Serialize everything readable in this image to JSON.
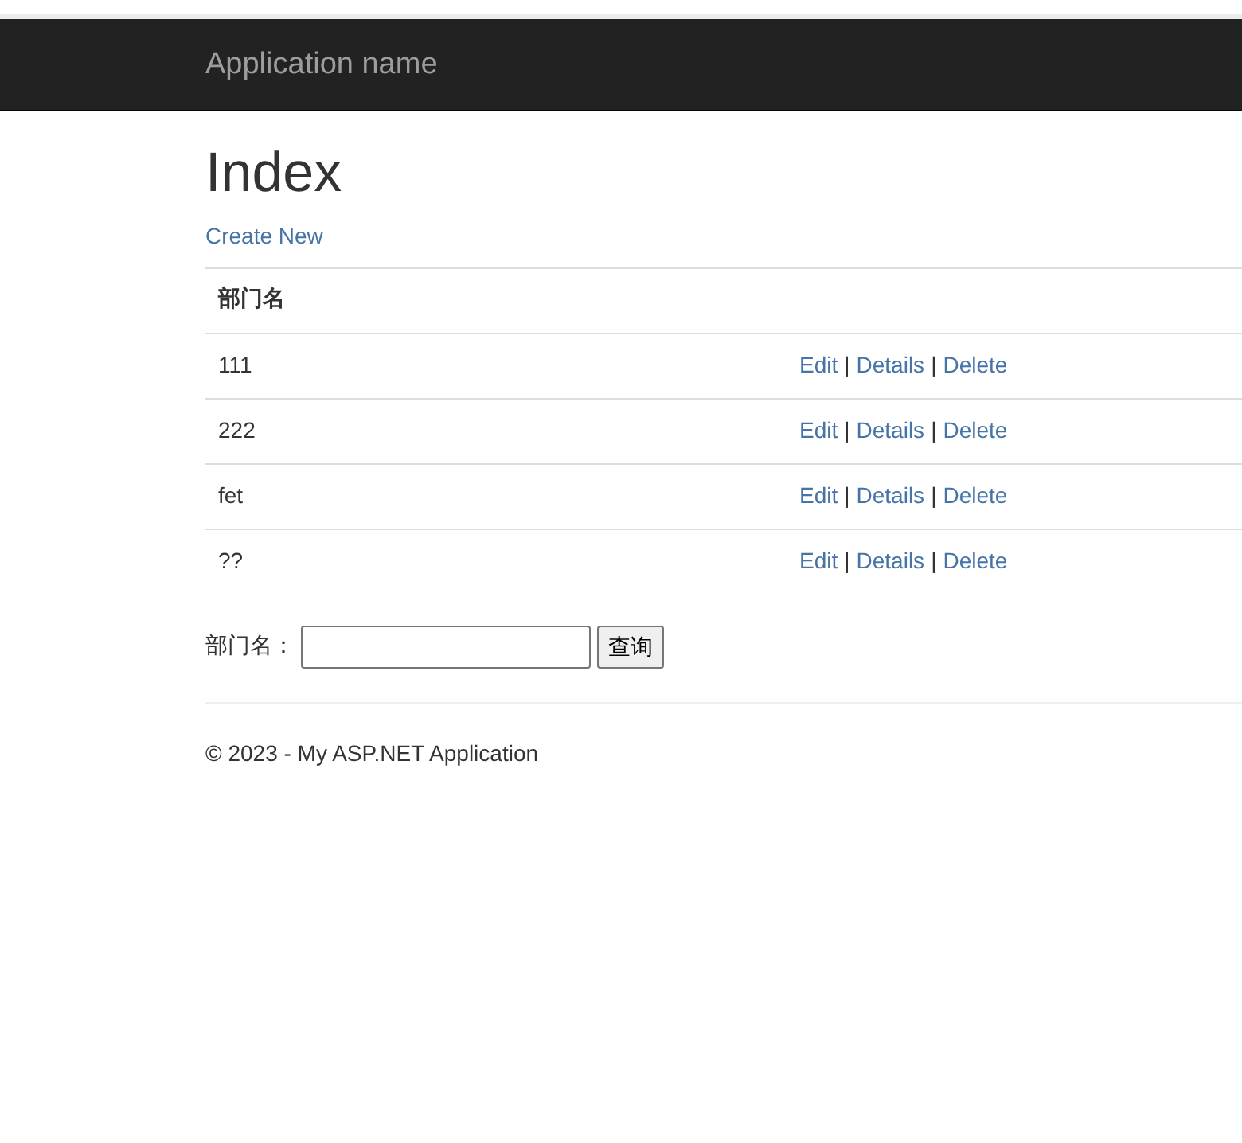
{
  "navbar": {
    "brand": "Application name"
  },
  "page": {
    "title": "Index",
    "create_link": "Create New"
  },
  "table": {
    "columns": [
      "部门名"
    ],
    "rows": [
      {
        "name": "111",
        "actions": [
          {
            "kind": "link",
            "text": "Edit"
          },
          {
            "kind": "separator",
            "text": "|"
          },
          {
            "kind": "link",
            "text": "Details"
          },
          {
            "kind": "separator",
            "text": "|"
          },
          {
            "kind": "link",
            "text": "Delete"
          }
        ]
      },
      {
        "name": "222",
        "actions": [
          {
            "kind": "link",
            "text": "Edit"
          },
          {
            "kind": "separator",
            "text": "|"
          },
          {
            "kind": "link",
            "text": "Details"
          },
          {
            "kind": "separator",
            "text": "|"
          },
          {
            "kind": "link",
            "text": "Delete"
          }
        ]
      },
      {
        "name": "fet",
        "actions": [
          {
            "kind": "link",
            "text": "Edit"
          },
          {
            "kind": "separator",
            "text": "|"
          },
          {
            "kind": "link",
            "text": "Details"
          },
          {
            "kind": "separator",
            "text": "|"
          },
          {
            "kind": "link",
            "text": "Delete"
          }
        ]
      },
      {
        "name": "??",
        "actions": [
          {
            "kind": "link",
            "text": "Edit"
          },
          {
            "kind": "separator",
            "text": "|"
          },
          {
            "kind": "link",
            "text": "Details"
          },
          {
            "kind": "separator",
            "text": "|"
          },
          {
            "kind": "link",
            "text": "Delete"
          }
        ]
      }
    ]
  },
  "search": {
    "label": "部门名：",
    "button": "查询"
  },
  "footer": {
    "text": "© 2023 - My ASP.NET Application"
  }
}
